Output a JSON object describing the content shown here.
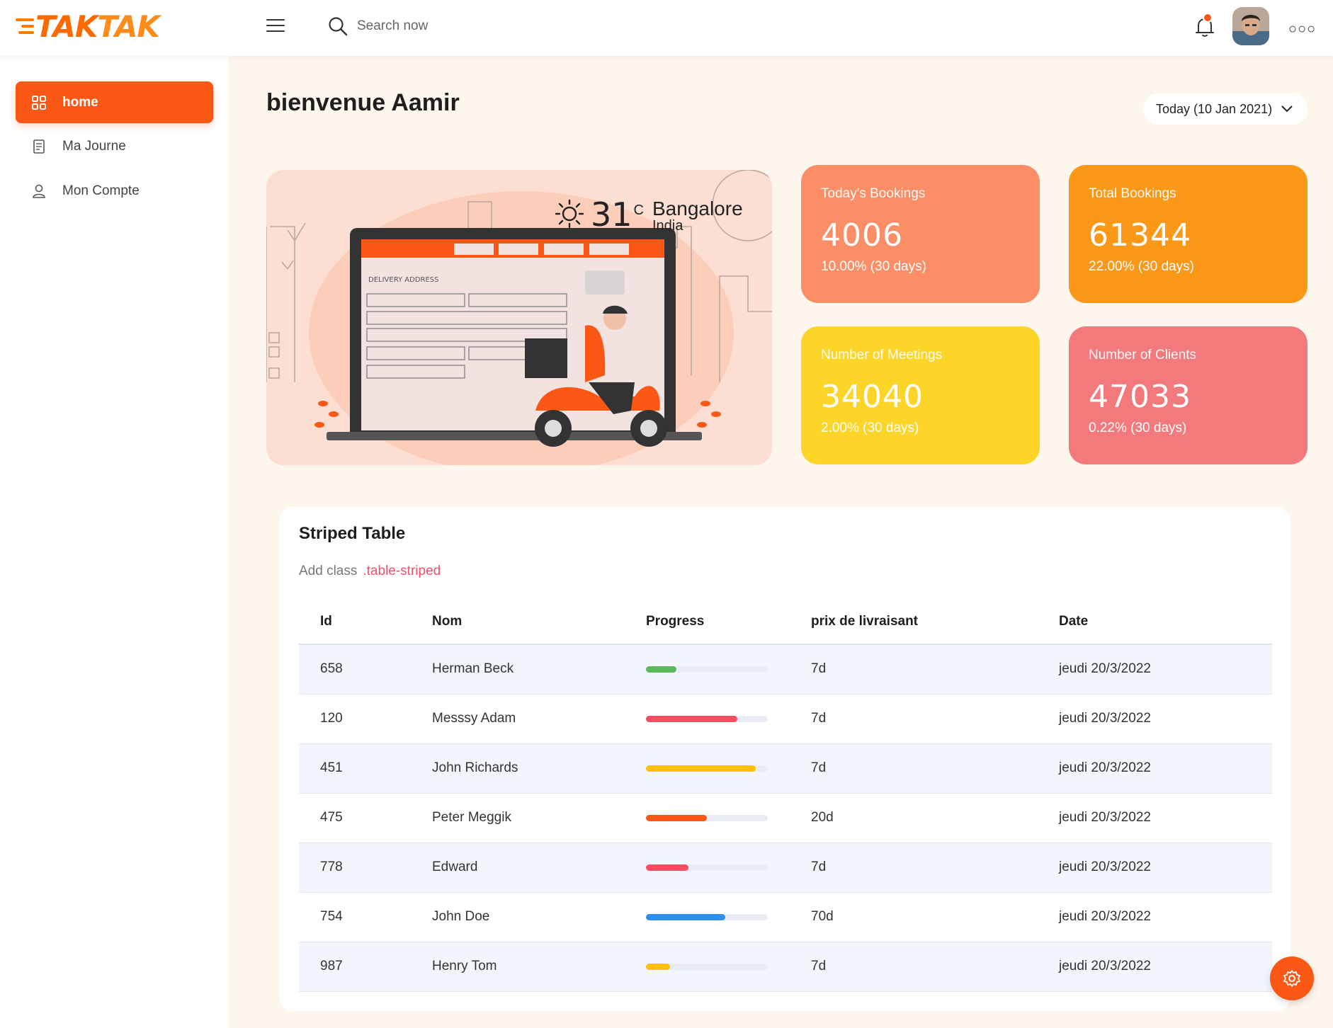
{
  "header": {
    "logo": {
      "part1": "TAK",
      "part2": "TAK"
    },
    "search": {
      "placeholder": "Search now"
    },
    "icons": [
      "menu-icon",
      "search-icon",
      "bell-icon",
      "more-icon"
    ],
    "notification_dot_color": "#fb5816"
  },
  "sidebar": {
    "items": [
      {
        "label": "home",
        "icon": "grid-icon",
        "active": true
      },
      {
        "label": "Ma Journe",
        "icon": "document-icon",
        "active": false
      },
      {
        "label": "Mon Compte",
        "icon": "user-icon",
        "active": false
      }
    ]
  },
  "main": {
    "welcome": "bienvenue Aamir",
    "date_label": "Today (10 Jan 2021)"
  },
  "weather": {
    "temp": "31",
    "unit": "C",
    "city": "Bangalore",
    "country": "India"
  },
  "hero": {
    "illustration_text": "DELIVERY ADDRESS"
  },
  "stats": [
    {
      "label": "Today's Bookings",
      "value": "4006",
      "sub": "10.00% (30 days)",
      "color": "#fb8e66"
    },
    {
      "label": "Total Bookings",
      "value": "61344",
      "sub": "22.00% (30 days)",
      "color": "#fb9817"
    },
    {
      "label": "Number of Meetings",
      "value": "34040",
      "sub": "2.00% (30 days)",
      "color": "#fdd428"
    },
    {
      "label": "Number of Clients",
      "value": "47033",
      "sub": "0.22% (30 days)",
      "color": "#f27a7d"
    }
  ],
  "table": {
    "title": "Striped Table",
    "subtitle": "Add class",
    "subtitle_code": ".table-striped",
    "columns": [
      "Id",
      "Nom",
      "Progress",
      "prix de livraisant",
      "Date"
    ],
    "rows": [
      {
        "id": "658",
        "name": "Herman Beck",
        "progress": 0.25,
        "progress_color": "#5cb85c",
        "price": "7d",
        "date": "jeudi 20/3/2022"
      },
      {
        "id": "120",
        "name": "Messsy Adam",
        "progress": 0.75,
        "progress_color": "#f64e60",
        "price": "7d",
        "date": "jeudi 20/3/2022"
      },
      {
        "id": "451",
        "name": "John Richards",
        "progress": 0.9,
        "progress_color": "#ffc107",
        "price": "7d",
        "date": "jeudi 20/3/2022"
      },
      {
        "id": "475",
        "name": "Peter Meggik",
        "progress": 0.5,
        "progress_color": "#fb5816",
        "price": "20d",
        "date": "jeudi 20/3/2022"
      },
      {
        "id": "778",
        "name": "Edward",
        "progress": 0.35,
        "progress_color": "#f64e60",
        "price": "7d",
        "date": "jeudi 20/3/2022"
      },
      {
        "id": "754",
        "name": "John Doe",
        "progress": 0.65,
        "progress_color": "#2f8ff0",
        "price": "70d",
        "date": "jeudi 20/3/2022"
      },
      {
        "id": "987",
        "name": "Henry Tom",
        "progress": 0.2,
        "progress_color": "#ffc107",
        "price": "7d",
        "date": "jeudi 20/3/2022"
      }
    ]
  },
  "fab": {
    "icon": "gear-icon"
  }
}
